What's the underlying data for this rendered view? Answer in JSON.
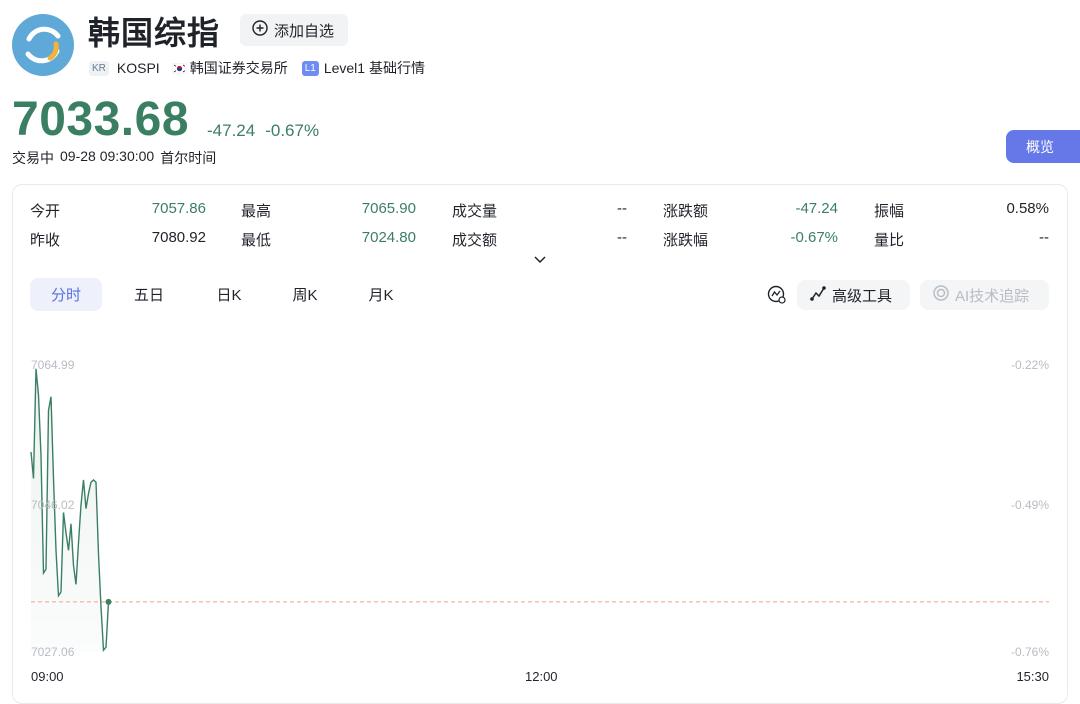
{
  "header": {
    "title": "韩国综指",
    "watch_label": "添加自选",
    "region_badge": "KR",
    "code": "KOSPI",
    "exchange": "韩国证券交易所",
    "level_badge": "L1",
    "level_label": "Level1 基础行情"
  },
  "quote": {
    "price": "7033.68",
    "change": "-47.24",
    "change_pct": "-0.67%",
    "status": "交易中",
    "datetime": "09-28 09:30:00",
    "timezone": "首尔时间"
  },
  "overview_label": "概览",
  "stats": [
    {
      "label": "今开",
      "value": "7057.86"
    },
    {
      "label": "最高",
      "value": "7065.90"
    },
    {
      "label": "成交量",
      "value": "--"
    },
    {
      "label": "涨跌额",
      "value": "-47.24"
    },
    {
      "label": "振幅",
      "value": "0.58%"
    },
    {
      "label": "昨收",
      "value": "7080.92"
    },
    {
      "label": "最低",
      "value": "7024.80"
    },
    {
      "label": "成交额",
      "value": "--"
    },
    {
      "label": "涨跌幅",
      "value": "-0.67%"
    },
    {
      "label": "量比",
      "value": "--"
    }
  ],
  "tabs": [
    {
      "label": "分时",
      "active": true
    },
    {
      "label": "五日"
    },
    {
      "label": "日K"
    },
    {
      "label": "周K"
    },
    {
      "label": "月K"
    }
  ],
  "tools": {
    "advanced_label": "高级工具",
    "ai_label": "AI技术追踪"
  },
  "colors": {
    "down_green": "#3b7f63",
    "accent_blue": "#6678e8",
    "ref_line": "#f0a58f"
  },
  "chart_data": {
    "type": "line",
    "y_labels_left": [
      "7064.99",
      "7046.02",
      "7027.06"
    ],
    "y_labels_right": [
      "-0.22%",
      "-0.49%",
      "-0.76%"
    ],
    "x_labels": [
      "09:00",
      "12:00",
      "15:30"
    ],
    "ylim": [
      7027.06,
      7064.99
    ],
    "reference_value": 7033.68,
    "series": [
      {
        "values": [
          7053.5,
          7050.0,
          7064.5,
          7061.0,
          7053.0,
          7037.5,
          7038.0,
          7059.0,
          7060.8,
          7050.0,
          7040.5,
          7034.5,
          7035.0,
          7045.5,
          7042.8,
          7040.5,
          7044.0,
          7038.5,
          7036.0,
          7041.5,
          7046.5,
          7049.8,
          7046.0,
          7048.0,
          7049.5,
          7049.8,
          7049.5,
          7040.0,
          7033.0,
          7027.3,
          7027.7,
          7033.68
        ]
      }
    ]
  }
}
